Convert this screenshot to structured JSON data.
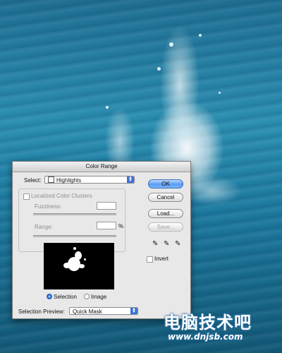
{
  "dialog": {
    "title": "Color Range",
    "select_label": "Select:",
    "select_value": "Highlights",
    "localized_clusters_label": "Localized Color Clusters",
    "fuzziness_label": "Fuzziness:",
    "fuzziness_value": "",
    "range_label": "Range:",
    "range_value": "",
    "range_unit": "%",
    "radio_selection_label": "Selection",
    "radio_image_label": "Image",
    "selected_radio": "Selection",
    "selection_preview_label": "Selection Preview:",
    "selection_preview_value": "Quick Mask",
    "buttons": {
      "ok": "OK",
      "cancel": "Cancel",
      "load": "Load...",
      "save": "Save..."
    },
    "invert_label": "Invert",
    "invert_checked": false,
    "eyedroppers": [
      "eyedropper",
      "eyedropper-plus",
      "eyedropper-minus"
    ]
  },
  "watermark": {
    "chinese": "电脑技术吧",
    "url": "www.dnjsb.com"
  }
}
